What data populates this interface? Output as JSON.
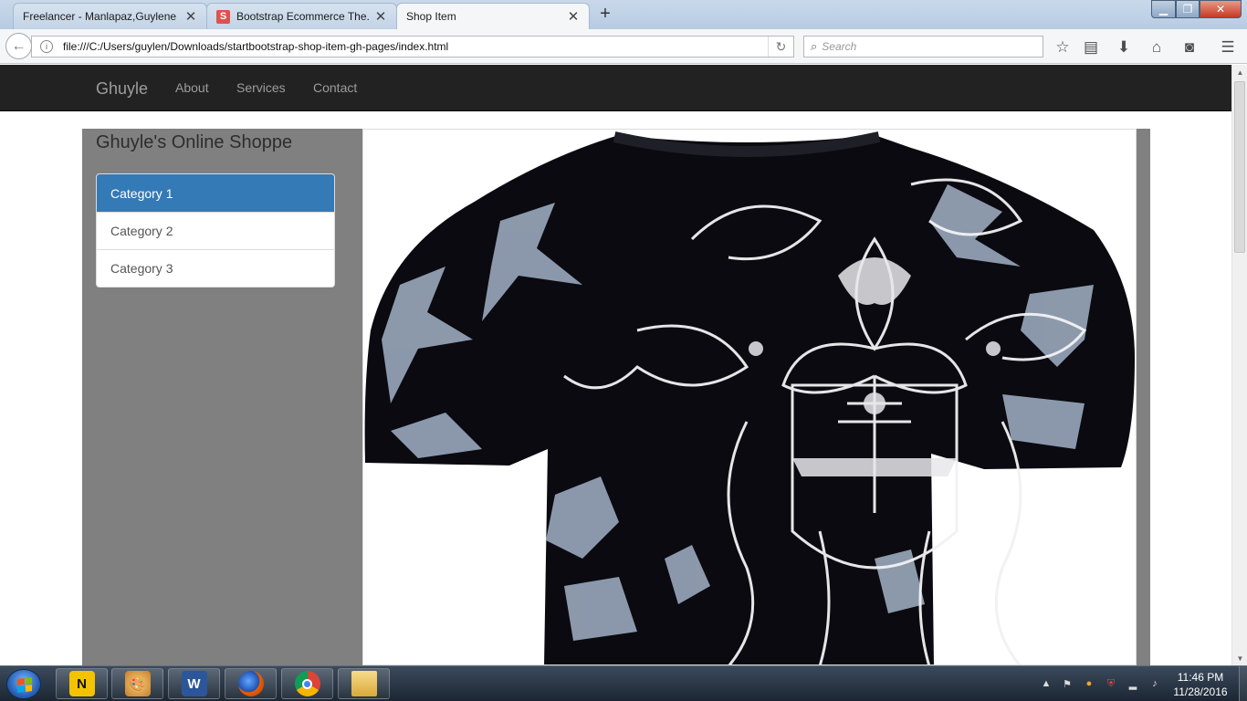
{
  "browser": {
    "tabs": [
      {
        "title": "Freelancer - Manlapaz,Guylene",
        "active": false
      },
      {
        "title": "Bootstrap Ecommerce The...",
        "active": false,
        "favicon": "S"
      },
      {
        "title": "Shop Item",
        "active": true
      }
    ],
    "url": "file:///C:/Users/guylen/Downloads/startbootstrap-shop-item-gh-pages/index.html",
    "search_placeholder": "Search",
    "icons": [
      "back-icon",
      "info-icon",
      "reload-icon",
      "search-icon",
      "bookmark-star-icon",
      "reading-list-icon",
      "download-icon",
      "home-icon",
      "pocket-icon",
      "menu-icon"
    ]
  },
  "site": {
    "brand": "Ghuyle",
    "nav": [
      "About",
      "Services",
      "Contact"
    ],
    "shop_title": "Ghuyle's Online Shoppe",
    "categories": [
      "Category 1",
      "Category 2",
      "Category 3"
    ],
    "active_category": "Category 1",
    "colors": {
      "navbar": "#222222",
      "active": "#337ab7",
      "container": "#808080"
    }
  },
  "taskbar": {
    "apps": [
      "norton-icon",
      "paint-icon",
      "word-icon",
      "firefox-icon",
      "chrome-icon",
      "folder-icon"
    ],
    "time": "11:46 PM",
    "date": "11/28/2016"
  }
}
